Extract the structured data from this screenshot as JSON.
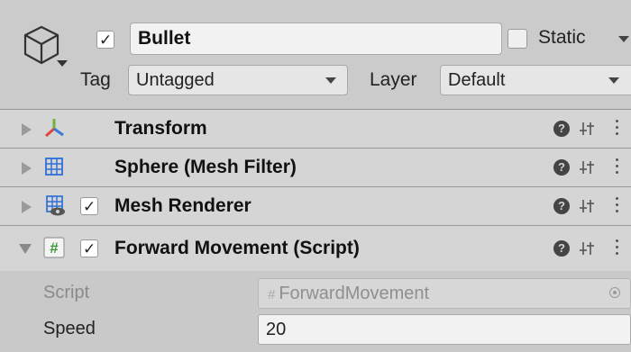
{
  "gameobject": {
    "active": true,
    "name": "Bullet",
    "static_label": "Static",
    "static_checked": false,
    "tag_label": "Tag",
    "tag_value": "Untagged",
    "layer_label": "Layer",
    "layer_value": "Default"
  },
  "components": [
    {
      "title": "Transform",
      "icon": "transform-icon",
      "expanded": false
    },
    {
      "title": "Sphere (Mesh Filter)",
      "icon": "mesh-filter-icon",
      "expanded": false
    },
    {
      "title": "Mesh Renderer",
      "icon": "mesh-renderer-icon",
      "expanded": false,
      "enabled": true
    },
    {
      "title": "Forward Movement (Script)",
      "icon": "script-icon",
      "expanded": true,
      "enabled": true
    }
  ],
  "script_fields": {
    "script_label": "Script",
    "script_value": "ForwardMovement",
    "speed_label": "Speed",
    "speed_value": "20"
  },
  "colors": {
    "panel_bg": "#c8c8c8",
    "header_bg": "#d5d5d5",
    "transform_red": "#e0463a",
    "transform_green": "#6fb33a",
    "transform_blue": "#3a78e0",
    "mesh_blue": "#2f6fd6",
    "script_green": "#3c9a3c"
  }
}
